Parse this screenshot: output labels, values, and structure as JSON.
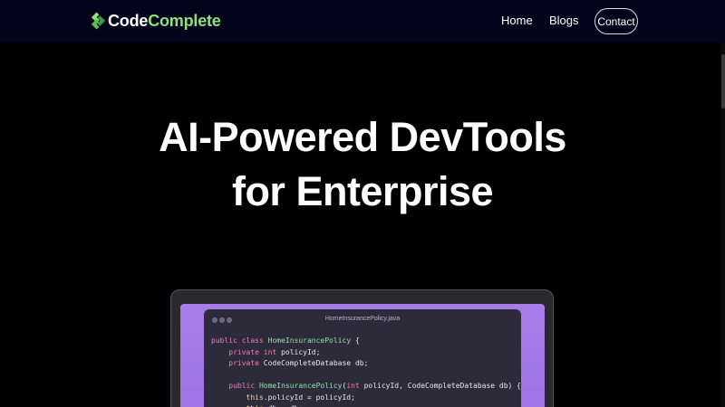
{
  "brand": {
    "name_part1": "Code",
    "name_part2": "Complete",
    "accent_color": "#8ee07a"
  },
  "nav": {
    "home": "Home",
    "blogs": "Blogs",
    "contact": "Contact"
  },
  "hero": {
    "title_line1": "AI-Powered DevTools",
    "title_line2": "for Enterprise"
  },
  "editor": {
    "file_name": "HomeInsurancePolicy.java",
    "lines": [
      {
        "indent": "",
        "tokens": [
          {
            "t": "public class ",
            "c": "kw"
          },
          {
            "t": "HomeInsurancePolicy",
            "c": "ty"
          },
          {
            "t": " {",
            "c": ""
          }
        ]
      },
      {
        "indent": "    ",
        "tokens": [
          {
            "t": "private int ",
            "c": "kw"
          },
          {
            "t": "policyId;",
            "c": ""
          }
        ]
      },
      {
        "indent": "    ",
        "tokens": [
          {
            "t": "private ",
            "c": "kw"
          },
          {
            "t": "CodeCompleteDatabase db;",
            "c": ""
          }
        ]
      },
      {
        "indent": "",
        "tokens": []
      },
      {
        "indent": "    ",
        "tokens": [
          {
            "t": "public ",
            "c": "kw"
          },
          {
            "t": "HomeInsurancePolicy",
            "c": "ty"
          },
          {
            "t": "(",
            "c": ""
          },
          {
            "t": "int ",
            "c": "kw"
          },
          {
            "t": "policyId, CodeCompleteDatabase db) {",
            "c": ""
          }
        ]
      },
      {
        "indent": "        ",
        "tokens": [
          {
            "t": "this",
            "c": "this"
          },
          {
            "t": ".policyId = policyId;",
            "c": ""
          }
        ]
      },
      {
        "indent": "        ",
        "tokens": [
          {
            "t": "this",
            "c": "this"
          },
          {
            "t": ".db = db;",
            "c": ""
          }
        ]
      }
    ]
  }
}
